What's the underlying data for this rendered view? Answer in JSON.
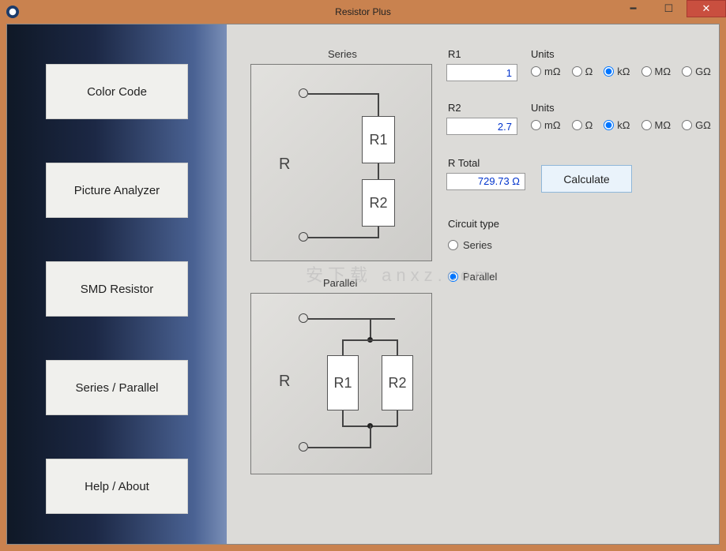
{
  "window": {
    "title": "Resistor Plus"
  },
  "sidebar": {
    "items": [
      {
        "label": "Color Code"
      },
      {
        "label": "Picture Analyzer"
      },
      {
        "label": "SMD Resistor"
      },
      {
        "label": "Series / Parallel"
      },
      {
        "label": "Help / About"
      }
    ]
  },
  "diagrams": {
    "series": {
      "title": "Series",
      "r_label": "R",
      "r1": "R1",
      "r2": "R2"
    },
    "parallel": {
      "title": "Parallel",
      "r_label": "R",
      "r1": "R1",
      "r2": "R2"
    }
  },
  "form": {
    "r1": {
      "label": "R1",
      "value": "1"
    },
    "r2": {
      "label": "R2",
      "value": "2.7"
    },
    "units_label": "Units",
    "unit_options": [
      "mΩ",
      "Ω",
      "kΩ",
      "MΩ",
      "GΩ"
    ],
    "r1_unit_selected": "kΩ",
    "r2_unit_selected": "kΩ",
    "rtotal": {
      "label": "R Total",
      "value": "729.73 Ω"
    },
    "calculate": "Calculate",
    "circuit_type": {
      "label": "Circuit type",
      "options": [
        "Series",
        "Parallel"
      ],
      "selected": "Parallel"
    }
  },
  "watermark": "安下载 anxz.com"
}
